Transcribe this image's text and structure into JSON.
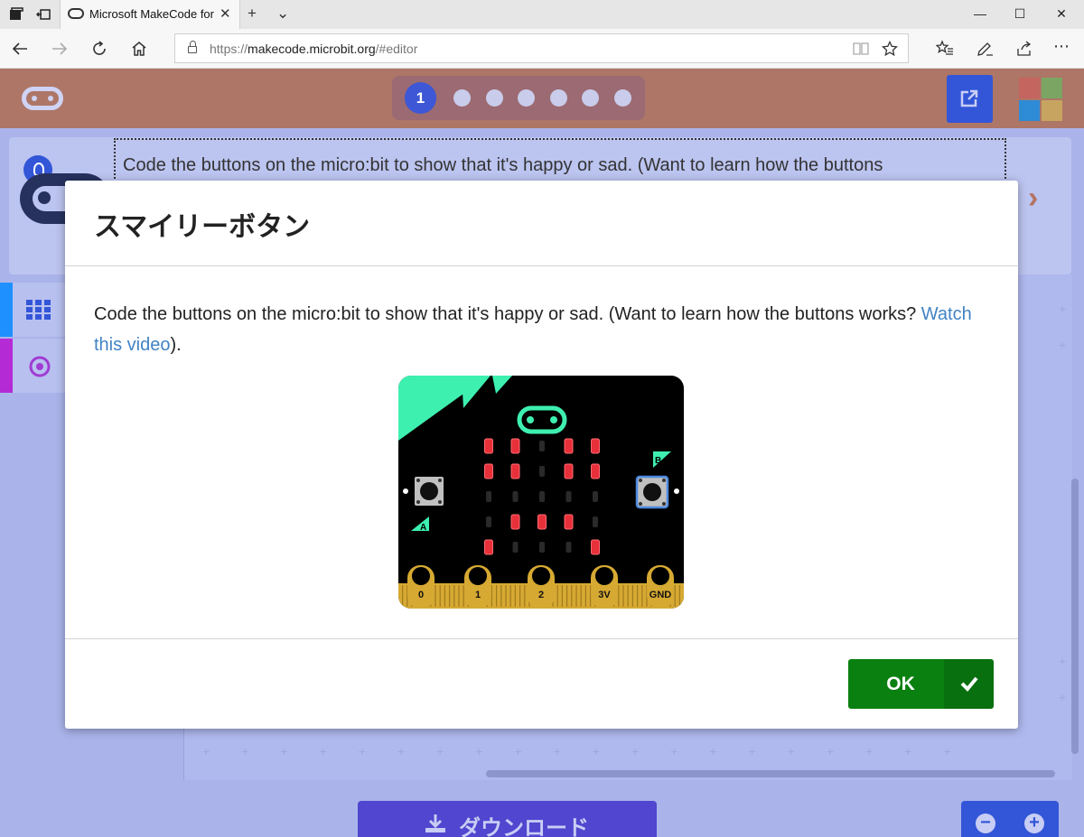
{
  "browser": {
    "tab_title": "Microsoft MakeCode for micro:bit",
    "tab_close": "✕",
    "new_tab": "+",
    "tab_menu": "⌄",
    "win_minimize": "—",
    "win_maximize": "☐",
    "win_close": "✕",
    "url_prefix": "https://",
    "url_host": "makecode.microbit.org",
    "url_path": "/#editor",
    "more_menu": "⋯"
  },
  "app": {
    "active_step": "1",
    "step_count": 7,
    "hint_text": "Code the buttons on the micro:bit to show that it's happy or sad. (Want to learn how the buttons",
    "download_label": "ダウンロード",
    "zoom_out": "−",
    "zoom_in": "+"
  },
  "modal": {
    "title": "スマイリーボタン",
    "body": "Code the buttons on the micro:bit to show that it's happy or sad. (Want to learn how the buttons works?",
    "link_text": "Watch this video",
    "after_link": ").",
    "ok_label": "OK",
    "board_pins": [
      "0",
      "1",
      "2",
      "3V",
      "GND"
    ],
    "board_button_a": "A",
    "board_button_b": "B"
  },
  "colors": {
    "header": "#ad7667",
    "accent_blue": "#3356d8",
    "ok_green": "#0a8010",
    "link": "#4183c4",
    "led_on": "#e8303a",
    "board_teal": "#3ef0b0",
    "pin_gold": "#d6a932"
  }
}
